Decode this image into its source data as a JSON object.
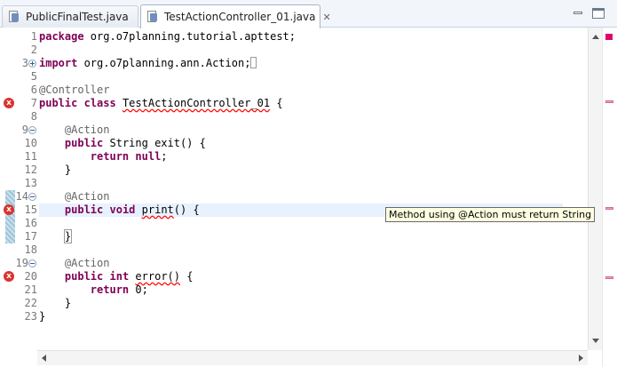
{
  "tabs": [
    {
      "label": "PublicFinalTest.java",
      "active": false
    },
    {
      "label": "TestActionController_01.java",
      "active": true,
      "close_glyph": "✕"
    }
  ],
  "lines": [
    {
      "n": "1",
      "tokens": [
        {
          "t": "package",
          "c": "kw"
        },
        {
          "t": " org.o7planning.tutorial.apttest;",
          "c": "plain"
        }
      ]
    },
    {
      "n": "2",
      "tokens": []
    },
    {
      "n": "3",
      "fold": "plus",
      "tokens": [
        {
          "t": "import",
          "c": "kw"
        },
        {
          "t": " org.o7planning.ann.Action;",
          "c": "plain"
        },
        {
          "t": "[]",
          "c": "box"
        }
      ]
    },
    {
      "n": "5",
      "tokens": []
    },
    {
      "n": "6",
      "tokens": [
        {
          "t": "@Controller",
          "c": "ann"
        }
      ]
    },
    {
      "n": "7",
      "error": true,
      "tokens": [
        {
          "t": "public",
          "c": "kw"
        },
        {
          "t": " ",
          "c": "plain"
        },
        {
          "t": "class",
          "c": "kw"
        },
        {
          "t": " ",
          "c": "plain"
        },
        {
          "t": "TestActionController_01",
          "c": "err"
        },
        {
          "t": " {",
          "c": "plain"
        }
      ]
    },
    {
      "n": "8",
      "tokens": []
    },
    {
      "n": "9",
      "fold": "minus",
      "tokens": [
        {
          "t": "    ",
          "c": "plain"
        },
        {
          "t": "@Action",
          "c": "ann"
        }
      ]
    },
    {
      "n": "10",
      "tokens": [
        {
          "t": "    ",
          "c": "plain"
        },
        {
          "t": "public",
          "c": "kw"
        },
        {
          "t": " String exit() {",
          "c": "plain"
        }
      ]
    },
    {
      "n": "11",
      "tokens": [
        {
          "t": "        ",
          "c": "plain"
        },
        {
          "t": "return",
          "c": "kw"
        },
        {
          "t": " ",
          "c": "plain"
        },
        {
          "t": "null",
          "c": "kw"
        },
        {
          "t": ";",
          "c": "plain"
        }
      ]
    },
    {
      "n": "12",
      "tokens": [
        {
          "t": "    }",
          "c": "plain"
        }
      ]
    },
    {
      "n": "13",
      "tokens": []
    },
    {
      "n": "14",
      "fold": "minus",
      "tokens": [
        {
          "t": "    ",
          "c": "plain"
        },
        {
          "t": "@Action",
          "c": "ann"
        }
      ]
    },
    {
      "n": "15",
      "error": true,
      "highlight": true,
      "tokens": [
        {
          "t": "    ",
          "c": "plain"
        },
        {
          "t": "public",
          "c": "kw"
        },
        {
          "t": " ",
          "c": "plain"
        },
        {
          "t": "void",
          "c": "kw"
        },
        {
          "t": " ",
          "c": "plain"
        },
        {
          "t": "print",
          "c": "err"
        },
        {
          "t": "() {",
          "c": "plain"
        }
      ]
    },
    {
      "n": "16",
      "tokens": []
    },
    {
      "n": "17",
      "tokens": [
        {
          "t": "    ",
          "c": "plain"
        },
        {
          "t": "}",
          "c": "bracket"
        }
      ]
    },
    {
      "n": "18",
      "tokens": []
    },
    {
      "n": "19",
      "fold": "minus",
      "tokens": [
        {
          "t": "    ",
          "c": "plain"
        },
        {
          "t": "@Action",
          "c": "ann"
        }
      ]
    },
    {
      "n": "20",
      "error": true,
      "tokens": [
        {
          "t": "    ",
          "c": "plain"
        },
        {
          "t": "public",
          "c": "kw"
        },
        {
          "t": " ",
          "c": "plain"
        },
        {
          "t": "int",
          "c": "kw"
        },
        {
          "t": " ",
          "c": "plain"
        },
        {
          "t": "error()",
          "c": "err"
        },
        {
          "t": " {",
          "c": "plain"
        }
      ]
    },
    {
      "n": "21",
      "tokens": [
        {
          "t": "        ",
          "c": "plain"
        },
        {
          "t": "return",
          "c": "kw"
        },
        {
          "t": " 0;",
          "c": "plain"
        }
      ]
    },
    {
      "n": "22",
      "tokens": [
        {
          "t": "    }",
          "c": "plain"
        }
      ]
    },
    {
      "n": "23",
      "tokens": [
        {
          "t": "}",
          "c": "plain"
        }
      ]
    }
  ],
  "tooltip": {
    "text": "Method using @Action must return String"
  },
  "error_glyph": "x",
  "colors": {
    "keyword": "#7f0055",
    "annotation": "#646464",
    "error_underline": "#ff0000",
    "error_icon": "#d8352f",
    "tooltip_bg": "#ffffe1",
    "current_line": "#e8f2fe"
  }
}
